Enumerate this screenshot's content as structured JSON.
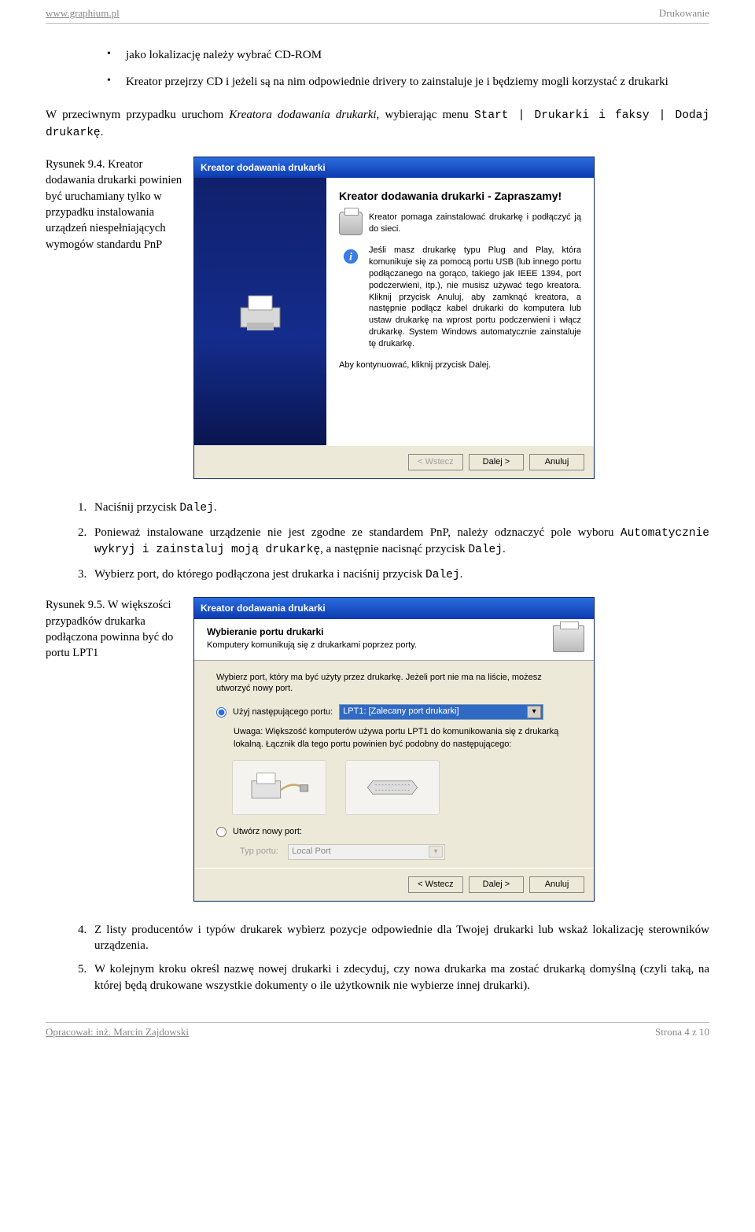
{
  "header": {
    "site": "www.graphium.pl",
    "section": "Drukowanie"
  },
  "footer": {
    "author": "Opracował: inż. Marcin Zajdowski",
    "page": "Strona 4 z 10"
  },
  "bullets": [
    "jako lokalizację należy wybrać CD-ROM",
    "Kreator przejrzy CD i jeżeli są na nim odpowiednie drivery to zainstaluje je i będziemy mogli korzystać z drukarki"
  ],
  "para1": {
    "pre": "W przeciwnym przypadku uruchom ",
    "em": "Kreatora dodawania drukarki",
    "mid": ", wybierając menu ",
    "code1": "Start | Drukarki i faksy | Dodaj drukarkę",
    "post": "."
  },
  "fig94": {
    "caption": "Rysunek 9.4. Kreator dodawania drukarki powinien być uruchamiany tylko w przypadku instalowania urządzeń niespełniających wymogów standardu PnP"
  },
  "wiz1": {
    "title": "Kreator dodawania drukarki",
    "heading": "Kreator dodawania drukarki - Zapraszamy!",
    "desc": "Kreator pomaga zainstalować drukarkę i podłączyć ją do sieci.",
    "info": "Jeśli masz drukarkę typu Plug and Play, która komunikuje się za pomocą portu USB (lub innego portu podłączanego na gorąco, takiego jak IEEE 1394, port podczerwieni, itp.), nie musisz używać tego kreatora. Kliknij przycisk Anuluj, aby zamknąć kreatora, a następnie podłącz kabel drukarki do komputera lub ustaw drukarkę na wprost portu podczerwieni i włącz drukarkę. System Windows automatycznie zainstaluje tę drukarkę.",
    "continue": "Aby kontynuować, kliknij przycisk Dalej.",
    "btn_back": "< Wstecz",
    "btn_next": "Dalej >",
    "btn_cancel": "Anuluj"
  },
  "steps_a": [
    {
      "pre": "Naciśnij przycisk ",
      "code": "Dalej",
      "post": "."
    },
    {
      "pre": "Ponieważ instalowane urządzenie nie jest zgodne ze standardem PnP, należy odznaczyć pole wyboru ",
      "code": "Automatycznie wykryj i zainstaluj moją drukarkę",
      "mid": ", a następnie nacisnąć przycisk ",
      "code2": "Dalej",
      "post": "."
    },
    {
      "pre": "Wybierz port, do którego podłączona jest drukarka i naciśnij przycisk ",
      "code": "Dalej",
      "post": "."
    }
  ],
  "fig95": {
    "caption": "Rysunek 9.5. W większości przypadków drukarka podłączona powinna być do portu LPT1"
  },
  "wiz2": {
    "title": "Kreator dodawania drukarki",
    "header_title": "Wybieranie portu drukarki",
    "header_sub": "Komputery komunikują się z drukarkami poprzez porty.",
    "intro": "Wybierz port, który ma być użyty przez drukarkę. Jeżeli port nie ma na liście, możesz utworzyć nowy port.",
    "radio1": "Użyj następującego portu:",
    "port_value": "LPT1: [Zalecany port drukarki]",
    "note": "Uwaga: Większość komputerów używa portu LPT1 do komunikowania się z drukarką lokalną. Łącznik dla tego portu powinien być podobny do następującego:",
    "radio2": "Utwórz nowy port:",
    "type_label": "Typ portu:",
    "type_value": "Local Port",
    "btn_back": "< Wstecz",
    "btn_next": "Dalej >",
    "btn_cancel": "Anuluj"
  },
  "steps_b": [
    "Z listy producentów i typów drukarek wybierz pozycje odpowiednie dla Twojej drukarki lub wskaż lokalizację sterowników urządzenia.",
    "W kolejnym kroku określ nazwę nowej drukarki i zdecyduj, czy nowa drukarka ma zostać drukarką domyślną (czyli taką, na której będą drukowane wszystkie dokumenty o ile użytkownik nie wybierze innej drukarki)."
  ]
}
